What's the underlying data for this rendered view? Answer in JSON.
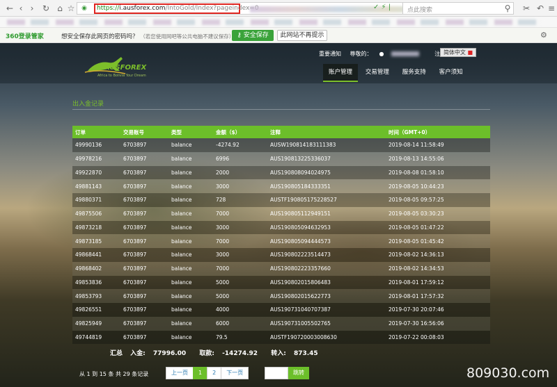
{
  "browser": {
    "url_protocol": "https://",
    "url_domain": "i.ausforex.com",
    "url_path": "/IntoGold/Index?pageindex=0",
    "search_placeholder": "点此搜索"
  },
  "password_bar": {
    "brand": "360登录管家",
    "message": "想安全保存此网页的密码吗？",
    "note": "（若您使用网吧等公共电脑不建议保存）",
    "save_label": "安全保存",
    "never_label": "此网站不再提示"
  },
  "site": {
    "logo_text": "AUSFOREX",
    "logo_sub": "Africa to Bolivia Your Dream",
    "top_links": {
      "notice": "重要通知",
      "greeting": "尊敬的：",
      "logout": "注销",
      "language": "简体中文"
    },
    "nav": [
      "账户管理",
      "交易管理",
      "服务支持",
      "客户须知"
    ],
    "section_title": "出入金记录"
  },
  "table": {
    "headers": [
      "订单",
      "交易账号",
      "类型",
      "金额（$）",
      "注释",
      "时间（GMT+0）"
    ],
    "rows": [
      [
        "49990136",
        "6703897",
        "balance",
        "-4274.92",
        "AUSW190814183111383",
        "2019-08-14 11:58:49"
      ],
      [
        "49978216",
        "6703897",
        "balance",
        "6996",
        "AUS190813225336037",
        "2019-08-13 14:55:06"
      ],
      [
        "49922870",
        "6703897",
        "balance",
        "2000",
        "AUS190808094024975",
        "2019-08-08 01:58:10"
      ],
      [
        "49881143",
        "6703897",
        "balance",
        "3000",
        "AUS190805184333351",
        "2019-08-05 10:44:23"
      ],
      [
        "49880371",
        "6703897",
        "balance",
        "728",
        "AUSTF190805175228527",
        "2019-08-05 09:57:25"
      ],
      [
        "49875506",
        "6703897",
        "balance",
        "7000",
        "AUS190805112949151",
        "2019-08-05 03:30:23"
      ],
      [
        "49873218",
        "6703897",
        "balance",
        "3000",
        "AUS190805094632953",
        "2019-08-05 01:47:22"
      ],
      [
        "49873185",
        "6703897",
        "balance",
        "7000",
        "AUS190805094444573",
        "2019-08-05 01:45:42"
      ],
      [
        "49868441",
        "6703897",
        "balance",
        "3000",
        "AUS190802223514473",
        "2019-08-02 14:36:13"
      ],
      [
        "49868402",
        "6703897",
        "balance",
        "7000",
        "AUS190802223357660",
        "2019-08-02 14:34:53"
      ],
      [
        "49853836",
        "6703897",
        "balance",
        "5000",
        "AUS190802015806483",
        "2019-08-01 17:59:12"
      ],
      [
        "49853793",
        "6703897",
        "balance",
        "5000",
        "AUS190802015622773",
        "2019-08-01 17:57:32"
      ],
      [
        "49826551",
        "6703897",
        "balance",
        "4000",
        "AUS190731040707387",
        "2019-07-30 20:07:46"
      ],
      [
        "49825949",
        "6703897",
        "balance",
        "6000",
        "AUS190731005502765",
        "2019-07-30 16:56:06"
      ],
      [
        "49744819",
        "6703897",
        "balance",
        "79.5",
        "AUSTF190720003008630",
        "2019-07-22 00:08:03"
      ]
    ]
  },
  "totals": {
    "summary_label": "汇总",
    "deposit_label": "入金:",
    "deposit_value": "77996.00",
    "withdraw_label": "取款:",
    "withdraw_value": "-14274.92",
    "transfer_label": "转入:",
    "transfer_value": "873.45"
  },
  "pager": {
    "info": "从 1 到 15 条 共 29 条记录",
    "prev": "上一页",
    "page1": "1",
    "page2": "2",
    "next": "下一页",
    "goto": "跳转"
  },
  "watermark": "809030.com",
  "colors": {
    "accent": "#6cbf2a",
    "url_highlight": "#e0241f",
    "save_button": "#3aa33a"
  }
}
